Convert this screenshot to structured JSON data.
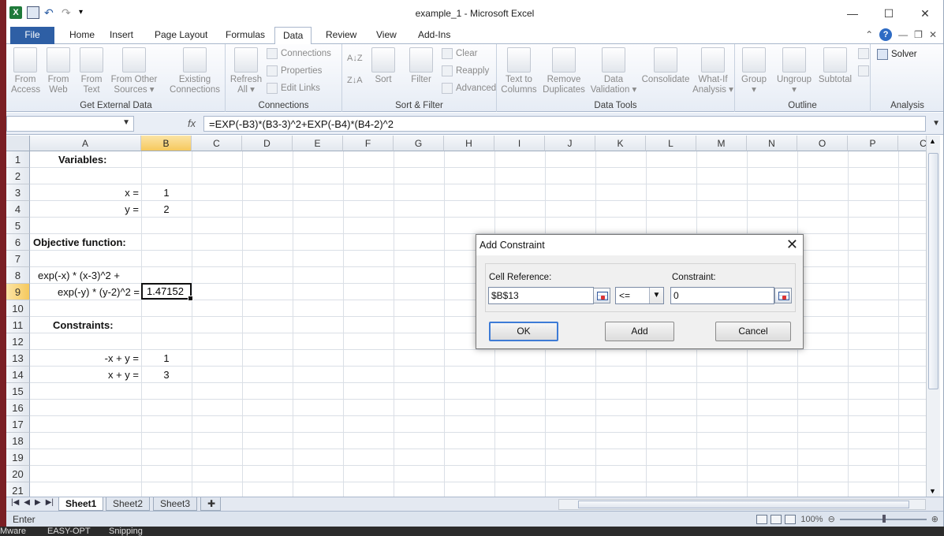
{
  "window": {
    "title": "example_1  -  Microsoft Excel"
  },
  "tabs": [
    {
      "label": "File"
    },
    {
      "label": "Home"
    },
    {
      "label": "Insert"
    },
    {
      "label": "Page Layout"
    },
    {
      "label": "Formulas"
    },
    {
      "label": "Data"
    },
    {
      "label": "Review"
    },
    {
      "label": "View"
    },
    {
      "label": "Add-Ins"
    }
  ],
  "ribbon": {
    "groups": {
      "external": "Get External Data",
      "connections": "Connections",
      "sortfilter": "Sort & Filter",
      "datatools": "Data Tools",
      "outline": "Outline",
      "analysis": "Analysis"
    },
    "buttons": {
      "from_access": "From\nAccess",
      "from_web": "From\nWeb",
      "from_text": "From\nText",
      "from_other": "From Other\nSources ▾",
      "existing": "Existing\nConnections",
      "refresh": "Refresh\nAll ▾",
      "connections": "Connections",
      "properties": "Properties",
      "edit_links": "Edit Links",
      "sort": "Sort",
      "filter": "Filter",
      "clear": "Clear",
      "reapply": "Reapply",
      "advanced": "Advanced",
      "text_to_columns": "Text to\nColumns",
      "remove_duplicates": "Remove\nDuplicates",
      "data_validation": "Data\nValidation ▾",
      "consolidate": "Consolidate",
      "what_if": "What-If\nAnalysis ▾",
      "group": "Group\n▾",
      "ungroup": "Ungroup\n▾",
      "subtotal": "Subtotal",
      "solver": "Solver"
    }
  },
  "formula_bar": {
    "name_box": "",
    "fx": "fx",
    "formula": "=EXP(-B3)*(B3-3)^2+EXP(-B4)*(B4-2)^2"
  },
  "grid": {
    "columns": [
      "A",
      "B",
      "C",
      "D",
      "E",
      "F",
      "G",
      "H",
      "I",
      "J",
      "K",
      "L",
      "M",
      "N",
      "O",
      "P",
      "C"
    ],
    "rows": [
      "1",
      "2",
      "3",
      "4",
      "5",
      "6",
      "7",
      "8",
      "9",
      "10",
      "11",
      "12",
      "13",
      "14",
      "15",
      "16",
      "17",
      "18",
      "19",
      "20",
      "21"
    ],
    "cells": {
      "a1": "Variables:",
      "a3": "x =",
      "b3": "1",
      "a4": "y =",
      "b4": "2",
      "a6": "Objective function:",
      "a8": "exp(-x) * (x-3)^2 +",
      "a9": "exp(-y) * (y-2)^2 =",
      "b9": "1.47152",
      "a11": "Constraints:",
      "a13": "-x + y =",
      "b13": "1",
      "a14": "x + y =",
      "b14": "3"
    }
  },
  "sheets": [
    {
      "label": "Sheet1"
    },
    {
      "label": "Sheet2"
    },
    {
      "label": "Sheet3"
    }
  ],
  "status": {
    "mode": "Enter",
    "zoom": "100%"
  },
  "dialog": {
    "title": "Add Constraint",
    "cell_ref_label": "Cell Reference:",
    "cell_ref_value": "$B$13",
    "operator": "<=",
    "constraint_label": "Constraint:",
    "constraint_value": "0",
    "ok": "OK",
    "add": "Add",
    "cancel": "Cancel"
  },
  "taskbar": {
    "items": [
      "Mware",
      "EASY-OPT",
      "Snipping"
    ]
  }
}
